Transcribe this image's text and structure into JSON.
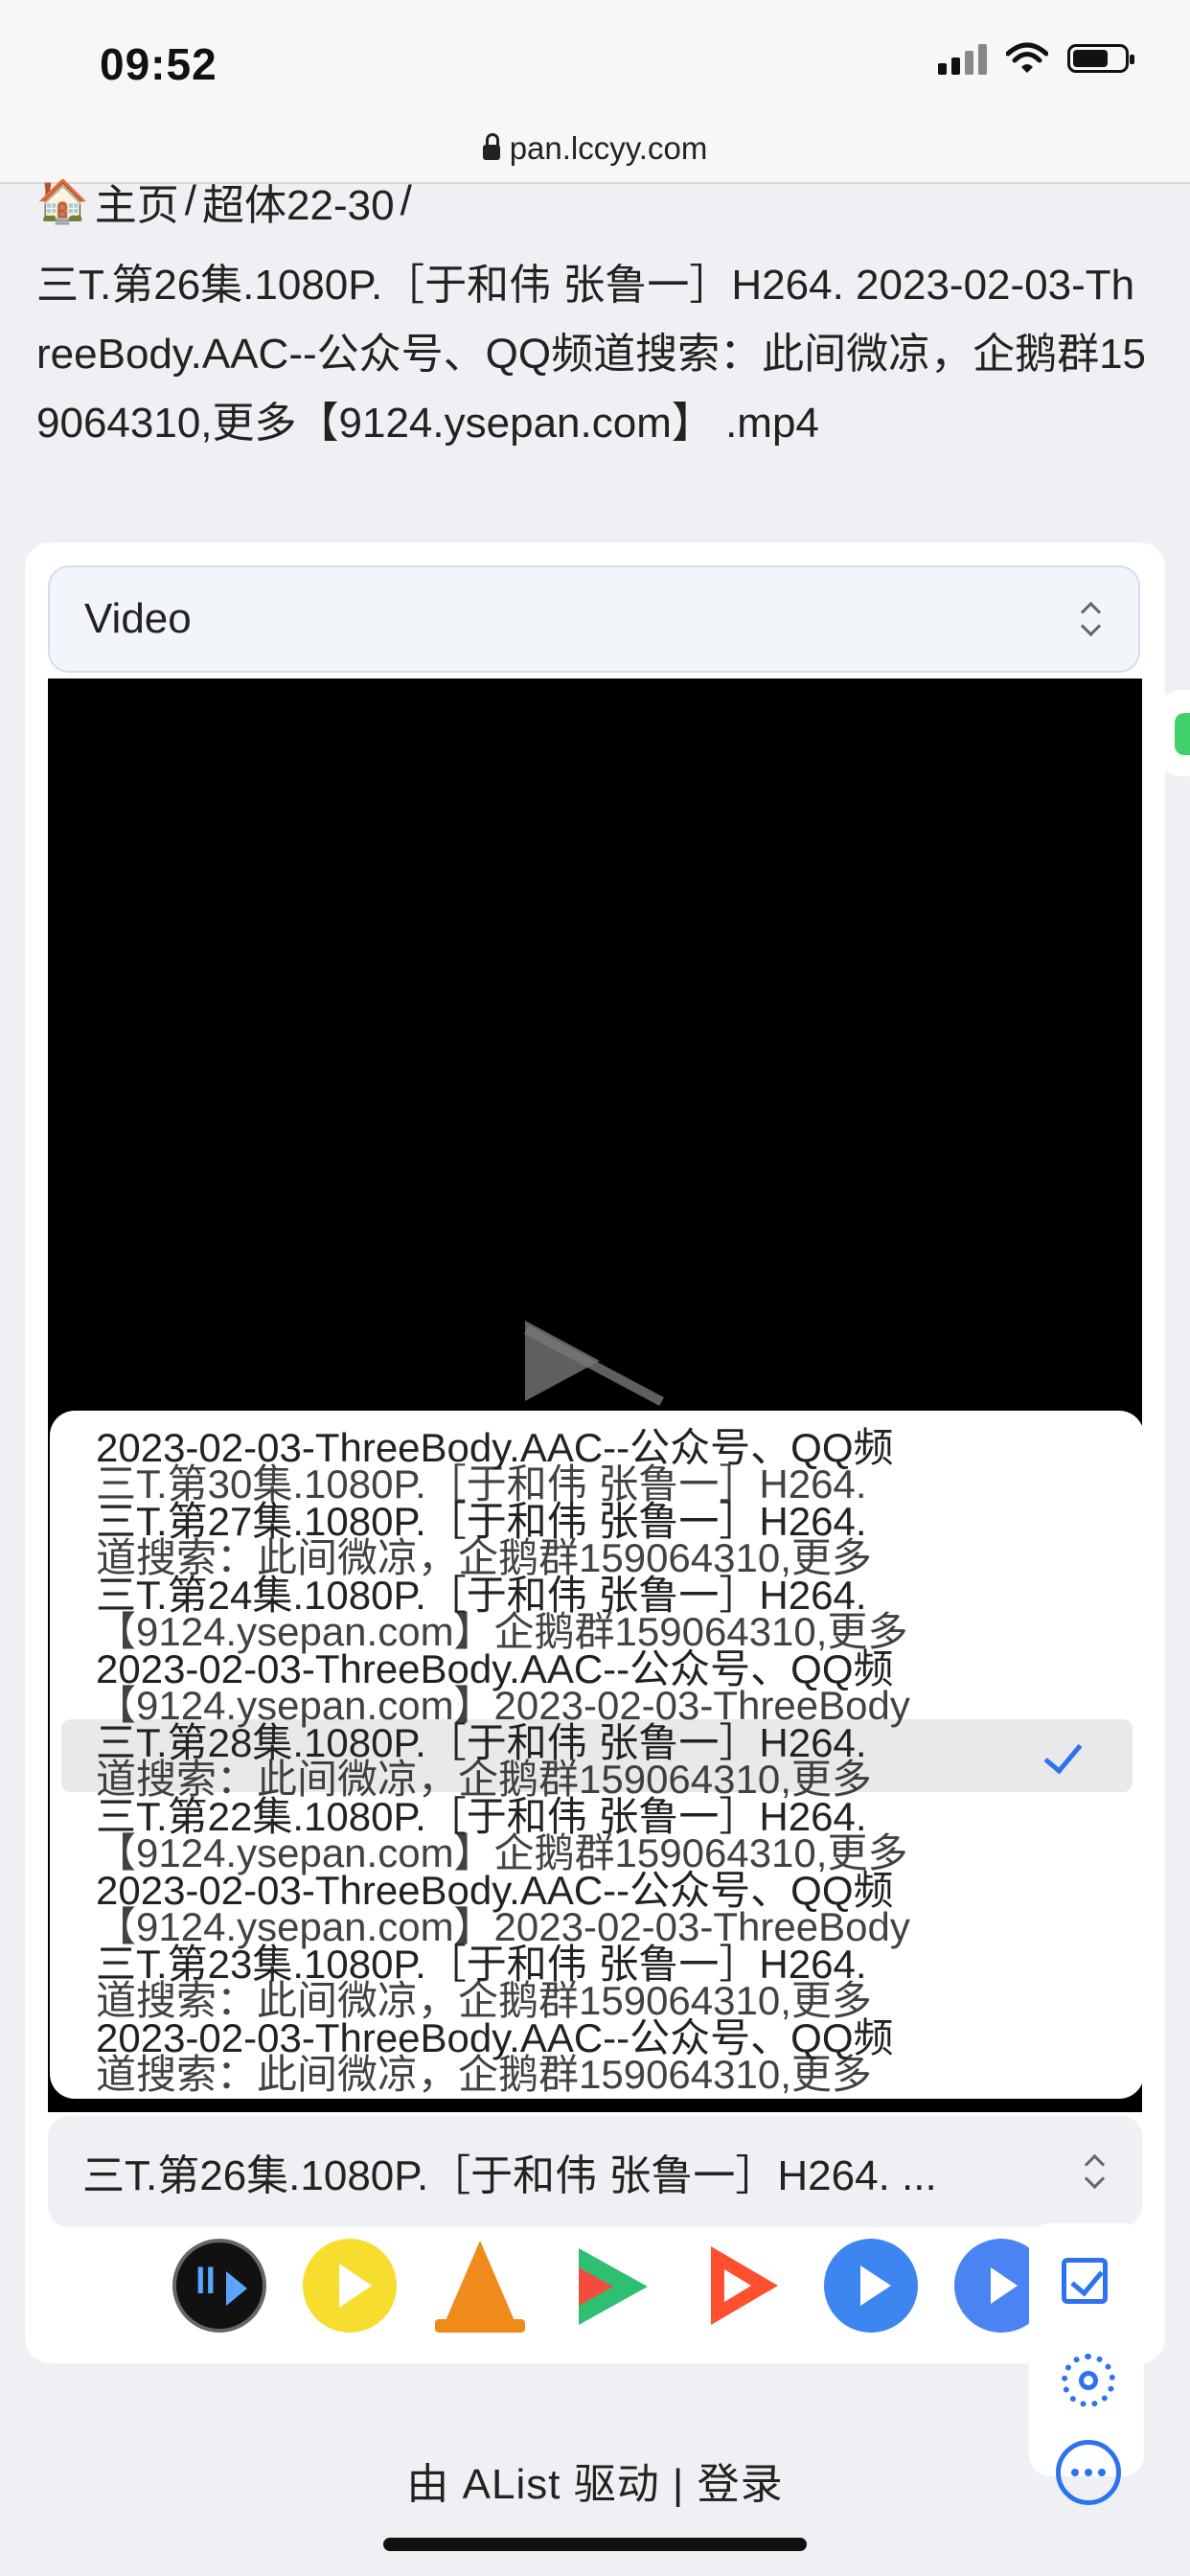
{
  "status_bar": {
    "time": "09:52"
  },
  "browser": {
    "url": "pan.lccyy.com"
  },
  "breadcrumb": {
    "home": "主页",
    "sep1": "/",
    "folder": "超体22-30",
    "sep2": "/"
  },
  "file": {
    "title": "三T.第26集.1080P.［于和伟 张鲁一］H264. 2023-02-03-ThreeBody.AAC--公众号、QQ频道搜索：此间微凉，企鹅群159064310,更多【9124.ysepan.com】 .mp4"
  },
  "video_select": {
    "value": "Video"
  },
  "dropdown": {
    "layer1": [
      "2023-02-03-ThreeBody.AAC--公众号、QQ频",
      "三T.第27集.1080P.［于和伟 张鲁一］H264.",
      "三T.第24集.1080P.［于和伟 张鲁一］H264.",
      "2023-02-03-ThreeBody.AAC--公众号、QQ频",
      "三T.第28集.1080P.［于和伟 张鲁一］H264.",
      "三T.第22集.1080P.［于和伟 张鲁一］H264.",
      "2023-02-03-ThreeBody.AAC--公众号、QQ频",
      "三T.第23集.1080P.［于和伟 张鲁一］H264.",
      "2023-02-03-ThreeBody.AAC--公众号、QQ频"
    ],
    "layer2": [
      "三T.第30集.1080P.［于和伟 张鲁一］H264.",
      "道搜索：此间微凉，企鹅群159064310,更多",
      "【9124.ysepan.com】企鹅群159064310,更多",
      "【9124.ysepan.com】2023-02-03-ThreeBody",
      "道搜索：此间微凉，企鹅群159064310,更多",
      "【9124.ysepan.com】企鹅群159064310,更多",
      "【9124.ysepan.com】2023-02-03-ThreeBody",
      "道搜索：此间微凉，企鹅群159064310,更多",
      "道搜索：此间微凉，企鹅群159064310,更多"
    ]
  },
  "episode_select": {
    "value": "三T.第26集.1080P.［于和伟 张鲁一］H264. ..."
  },
  "players": [
    {
      "name": "iina-player-icon"
    },
    {
      "name": "potplayer-icon"
    },
    {
      "name": "vlc-icon"
    },
    {
      "name": "google-play-icon"
    },
    {
      "name": "infuse-icon"
    },
    {
      "name": "blue-player-icon"
    },
    {
      "name": "mx-player-pro-icon"
    }
  ],
  "footer": {
    "text": "由 AList 驱动 | 登录"
  },
  "colors": {
    "accent": "#2d73f0",
    "background": "#eef0f4",
    "video": "#000000"
  }
}
